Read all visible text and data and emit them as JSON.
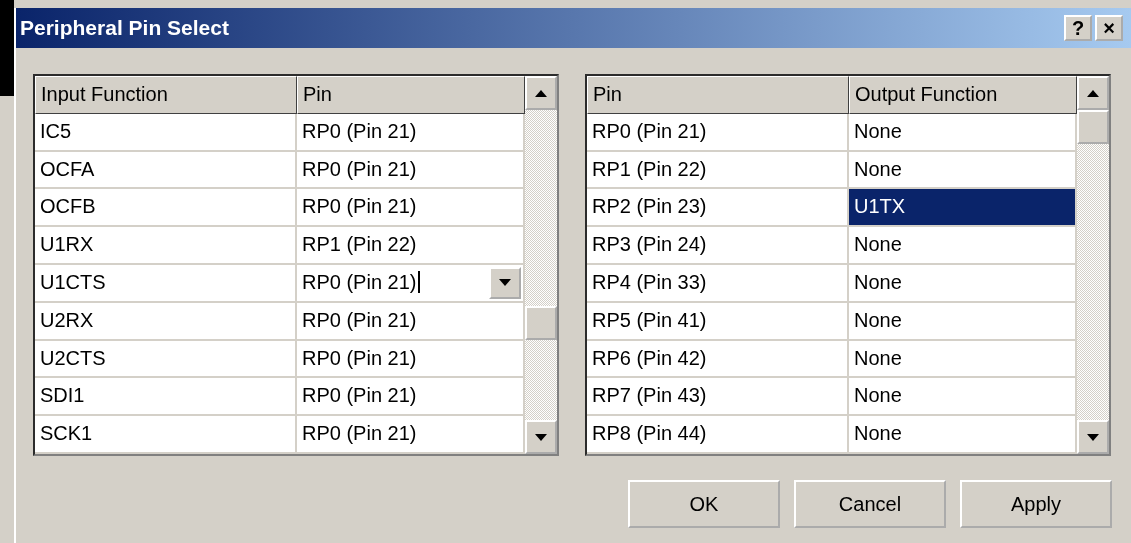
{
  "window": {
    "title": "Peripheral Pin Select",
    "help_button": "?",
    "close_button": "×"
  },
  "input_table": {
    "columns": [
      "Input Function",
      "Pin"
    ],
    "rows": [
      {
        "function": "IC5",
        "pin": "RP0 (Pin 21)",
        "editing": false
      },
      {
        "function": "OCFA",
        "pin": "RP0 (Pin 21)",
        "editing": false
      },
      {
        "function": "OCFB",
        "pin": "RP0 (Pin 21)",
        "editing": false
      },
      {
        "function": "U1RX",
        "pin": "RP1 (Pin 22)",
        "editing": false
      },
      {
        "function": "U1CTS",
        "pin": "RP0 (Pin 21)",
        "editing": true
      },
      {
        "function": "U2RX",
        "pin": "RP0 (Pin 21)",
        "editing": false
      },
      {
        "function": "U2CTS",
        "pin": "RP0 (Pin 21)",
        "editing": false
      },
      {
        "function": "SDI1",
        "pin": "RP0 (Pin 21)",
        "editing": false
      },
      {
        "function": "SCK1",
        "pin": "RP0 (Pin 21)",
        "editing": false
      }
    ]
  },
  "output_table": {
    "columns": [
      "Pin",
      "Output Function"
    ],
    "rows": [
      {
        "pin": "RP0 (Pin 21)",
        "function": "None",
        "selected": false
      },
      {
        "pin": "RP1 (Pin 22)",
        "function": "None",
        "selected": false
      },
      {
        "pin": "RP2 (Pin 23)",
        "function": "U1TX",
        "selected": true
      },
      {
        "pin": "RP3 (Pin 24)",
        "function": "None",
        "selected": false
      },
      {
        "pin": "RP4 (Pin 33)",
        "function": "None",
        "selected": false
      },
      {
        "pin": "RP5 (Pin 41)",
        "function": "None",
        "selected": false
      },
      {
        "pin": "RP6 (Pin 42)",
        "function": "None",
        "selected": false
      },
      {
        "pin": "RP7 (Pin 43)",
        "function": "None",
        "selected": false
      },
      {
        "pin": "RP8 (Pin 44)",
        "function": "None",
        "selected": false
      }
    ]
  },
  "buttons": [
    "OK",
    "Cancel",
    "Apply"
  ]
}
